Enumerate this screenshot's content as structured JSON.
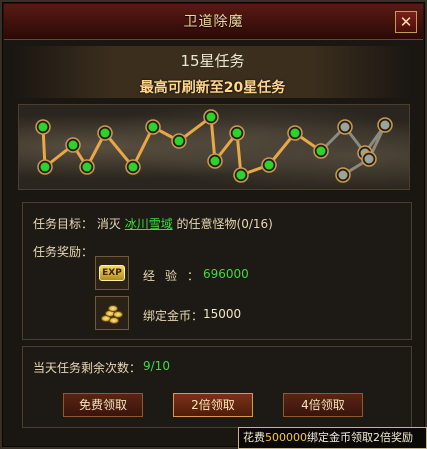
{
  "window": {
    "title": "卫道除魔",
    "close_label": "✕"
  },
  "header": {
    "star_task": "15星任务",
    "refresh_hint": "最高可刷新至20星任务"
  },
  "progress": {
    "completed_nodes": 15,
    "total_nodes": 20,
    "colors": {
      "active": "#2bd42b",
      "inactive": "#9aa59a",
      "path_active": "#e8a848"
    }
  },
  "task": {
    "goal_label": "任务目标：",
    "goal_prefix": "消灭",
    "monster": "冰川雪域",
    "goal_suffix": "的任意怪物(0/16)",
    "reward_label": "任务奖励：",
    "exp_icon_text": "EXP",
    "exp_name": "经验：",
    "exp_value": "696000",
    "gold_name": "绑定金币：",
    "gold_value": "15000"
  },
  "daily": {
    "remaining_label": "当天任务剩余次数：",
    "remaining_value": "9/10"
  },
  "buttons": {
    "free": "免费领取",
    "double": "2倍领取",
    "quadruple": "4倍领取"
  },
  "tooltip": {
    "prefix": "花费",
    "amount": "500000",
    "suffix": "绑定金币领取2倍奖励"
  }
}
